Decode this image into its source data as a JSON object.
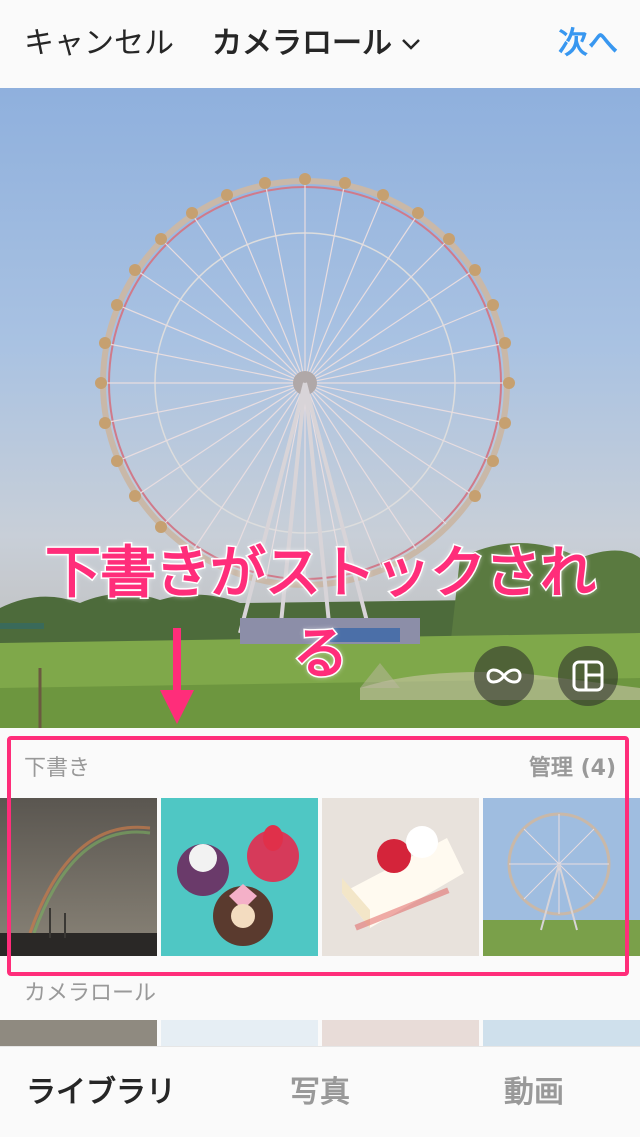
{
  "header": {
    "cancel_label": "キャンセル",
    "album_title": "カメラロール",
    "next_label": "次へ"
  },
  "preview": {
    "annotation_text": "下書きがストックされる",
    "boomerang_icon": "infinity-icon",
    "layout_icon": "layout-icon"
  },
  "drafts": {
    "label": "下書き",
    "manage_label": "管理 (4)",
    "thumbnails": [
      "rainbow-photo",
      "cupcakes-photo",
      "strawberry-shortcake-photo",
      "ferris-wheel-photo"
    ]
  },
  "camera_roll": {
    "label": "カメラロール"
  },
  "tabs": {
    "library": "ライブラリ",
    "photo": "写真",
    "video": "動画"
  },
  "colors": {
    "accent": "#3897f0",
    "annotation": "#ff2d7a",
    "text": "#262626",
    "muted": "#999999"
  }
}
